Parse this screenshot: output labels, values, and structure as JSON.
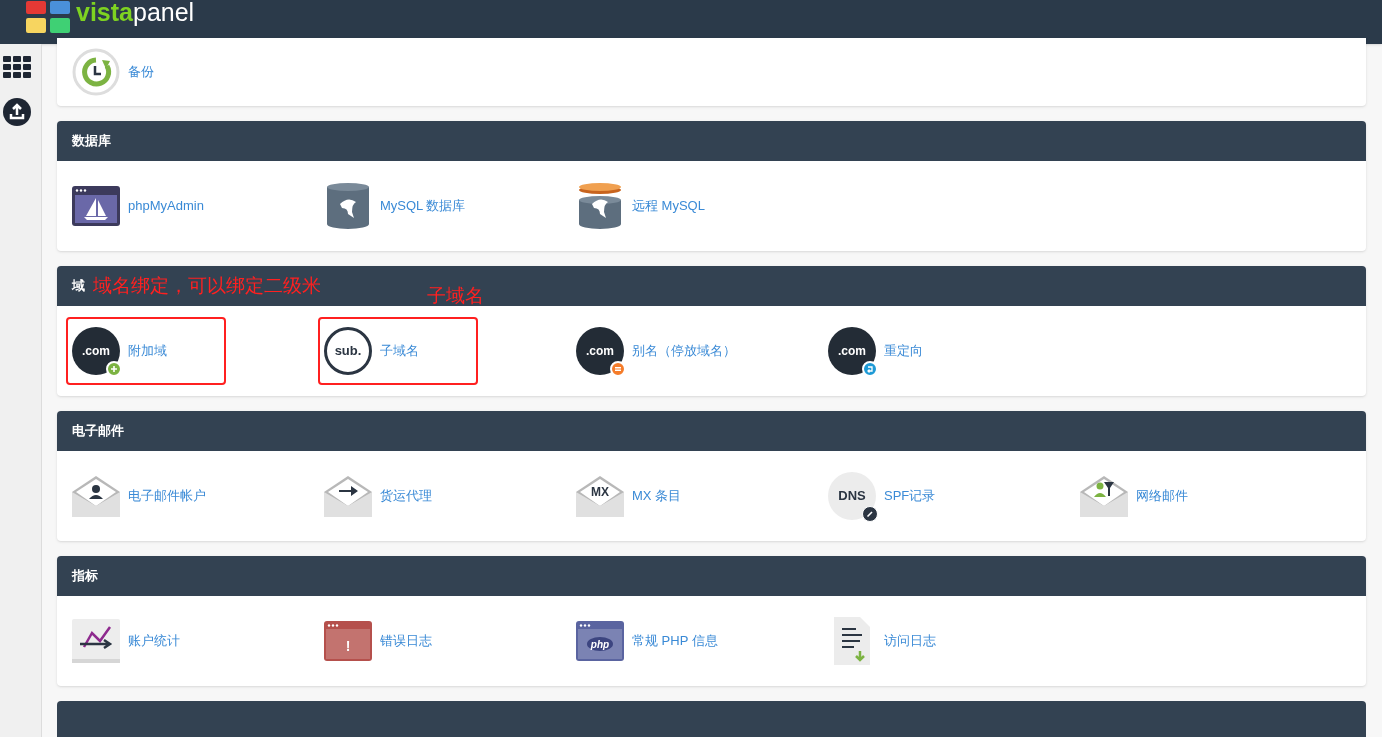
{
  "logo": {
    "part_1": "vista",
    "part_2": "panel"
  },
  "top_items": [
    {
      "kind": "backup",
      "label": "备份",
      "highlighted": false
    }
  ],
  "sections": [
    {
      "title": "数据库",
      "items": [
        {
          "kind": "phpmyadmin",
          "label": "phpMyAdmin",
          "highlighted": false
        },
        {
          "kind": "mysql",
          "label": "MySQL 数据库",
          "highlighted": false
        },
        {
          "kind": "remote-mysql",
          "label": "远程 MySQL",
          "highlighted": false
        }
      ]
    },
    {
      "title": "域",
      "annotation": "域名绑定，可以绑定二级米",
      "floating_note": "子域名",
      "items": [
        {
          "kind": "domain-plus",
          "icon_text": ".com",
          "color": "#7cb342",
          "label": "附加域",
          "highlighted": true
        },
        {
          "kind": "sub",
          "icon_text": "sub.",
          "label": "子域名",
          "highlighted": true
        },
        {
          "kind": "domain-equals",
          "icon_text": ".com",
          "color": "#f57c2a",
          "label": "别名（停放域名）",
          "highlighted": false
        },
        {
          "kind": "domain-redirect",
          "icon_text": ".com",
          "color": "#1e9ad6",
          "label": "重定向",
          "highlighted": false
        }
      ]
    },
    {
      "title": "电子邮件",
      "items": [
        {
          "kind": "envelope-person",
          "label": "电子邮件帐户",
          "highlighted": false
        },
        {
          "kind": "envelope-arrow",
          "label": "货运代理",
          "highlighted": false
        },
        {
          "kind": "envelope-text",
          "icon_text": "MX",
          "label": "MX 条目",
          "highlighted": false
        },
        {
          "kind": "dns",
          "icon_text": "DNS",
          "label": "SPF记录",
          "highlighted": false
        },
        {
          "kind": "envelope-filter",
          "label": "网络邮件",
          "highlighted": false
        }
      ]
    },
    {
      "title": "指标",
      "items": [
        {
          "kind": "stats",
          "label": "账户统计",
          "highlighted": false
        },
        {
          "kind": "window",
          "color": "#b5504c",
          "symbol": "!",
          "label": "错误日志",
          "highlighted": false
        },
        {
          "kind": "window",
          "color": "#5a64a0",
          "symbol": "php",
          "label": "常规 PHP 信息",
          "highlighted": false
        },
        {
          "kind": "log",
          "label": "访问日志",
          "highlighted": false
        }
      ]
    }
  ]
}
